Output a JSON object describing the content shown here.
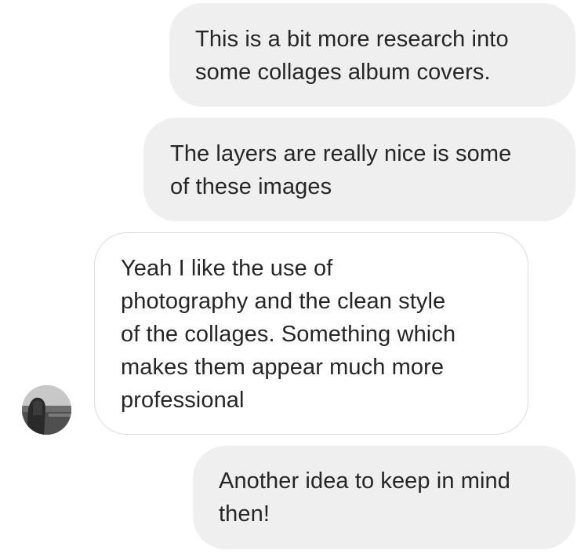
{
  "conversation": {
    "messages": [
      {
        "sender": "me",
        "text": "This is a bit more research into\nsome collages album covers."
      },
      {
        "sender": "me",
        "text": "The layers are really nice is some\nof these images"
      },
      {
        "sender": "other",
        "text": "Yeah I like the use of\nphotography and the clean style\nof the collages. Something which\nmakes them appear much more\nprofessional"
      },
      {
        "sender": "me",
        "text": "Another idea to keep in mind\nthen!"
      }
    ]
  },
  "colors": {
    "sent_bubble": "#efefef",
    "received_border": "#dbdbdb",
    "text": "#262626"
  },
  "icons": {
    "avatar": "avatar-photo-icon"
  }
}
